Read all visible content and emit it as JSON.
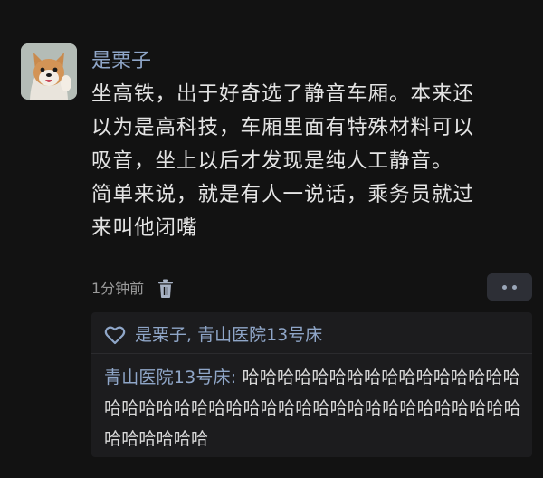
{
  "post": {
    "username": "是栗子",
    "content_lines": [
      "坐高铁，出于好奇选了静音车厢。本来还",
      "以为是高科技，车厢里面有特殊材料可以",
      "吸音，坐上以后才发现是纯人工静音。",
      "简单来说，就是有人一说话，乘务员就过",
      "来叫他闭嘴"
    ],
    "time": "1分钟前",
    "delete_icon": "trash-icon",
    "more_icon": "more-dots-icon"
  },
  "replies": {
    "like_icon": "heart-icon",
    "likers": "是栗子, 青山医院13号床",
    "comment": {
      "author": "青山医院13号床:",
      "text": " 哈哈哈哈哈哈哈哈哈哈哈哈哈哈哈哈哈哈哈哈哈哈哈哈哈哈哈哈哈哈哈哈哈哈哈哈哈哈哈哈哈哈哈哈哈哈"
    }
  },
  "colors": {
    "background": "#121212",
    "name_blue": "#8fa6c8",
    "text": "#e4e4e4",
    "muted": "#9a9a9a"
  }
}
